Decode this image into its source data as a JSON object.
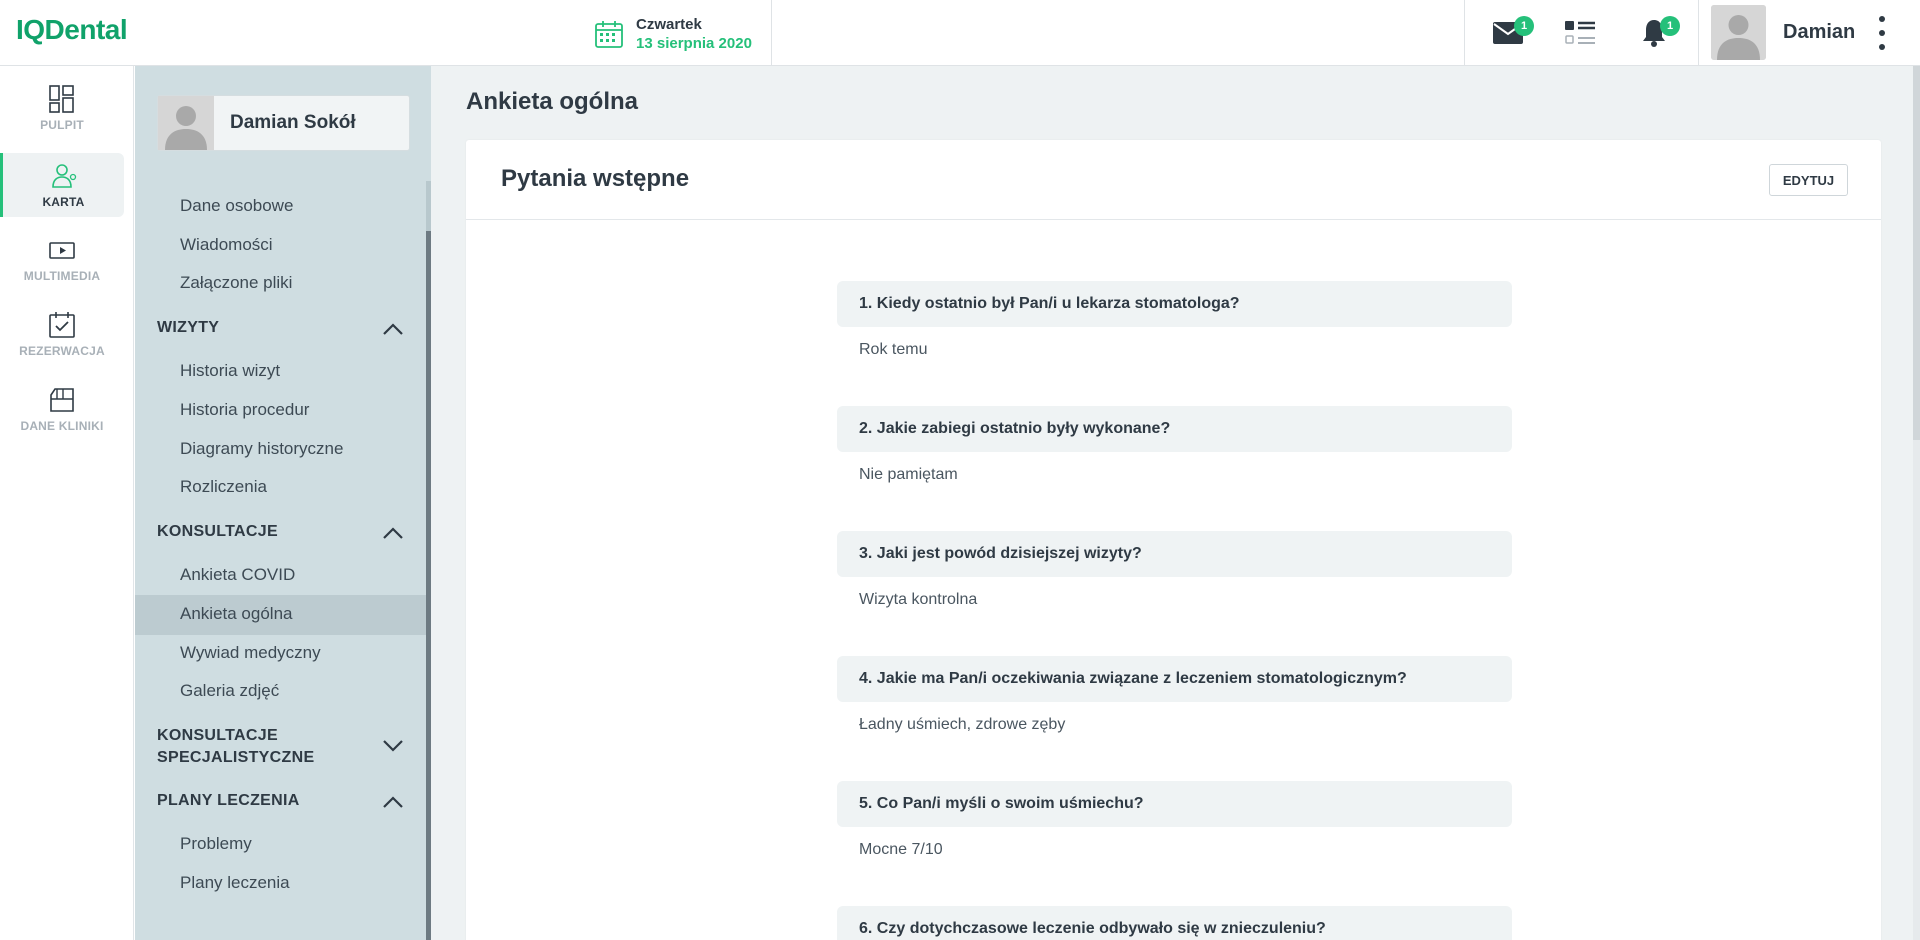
{
  "app": {
    "logo": "IQDental"
  },
  "header": {
    "day": "Czwartek",
    "date": "13 sierpnia 2020",
    "mail_badge": "1",
    "notif_badge": "1",
    "user_name": "Damian"
  },
  "rail": {
    "items": [
      {
        "label": "PULPIT",
        "icon": "dashboard-icon"
      },
      {
        "label": "KARTA",
        "icon": "patient-card-icon"
      },
      {
        "label": "MULTIMEDIA",
        "icon": "multimedia-icon"
      },
      {
        "label": "REZERWACJA",
        "icon": "calendar-check-icon"
      },
      {
        "label": "DANE KLINIKI",
        "icon": "clinic-data-icon"
      }
    ],
    "active": "KARTA"
  },
  "sidebar": {
    "patient_name": "Damian Sokół",
    "top_links": [
      "Dane osobowe",
      "Wiadomości",
      "Załączone pliki"
    ],
    "sections": [
      {
        "title": "WIZYTY",
        "expanded": true,
        "links": [
          "Historia wizyt",
          "Historia procedur",
          "Diagramy historyczne",
          "Rozliczenia"
        ]
      },
      {
        "title": "KONSULTACJE",
        "expanded": true,
        "links": [
          "Ankieta COVID",
          "Ankieta ogólna",
          "Wywiad medyczny",
          "Galeria zdjęć"
        ]
      },
      {
        "title_line1": "KONSULTACJE",
        "title_line2": "SPECJALISTYCZNE",
        "expanded": false,
        "links": []
      },
      {
        "title": "PLANY LECZENIA",
        "expanded": true,
        "links": [
          "Problemy",
          "Plany leczenia"
        ]
      }
    ],
    "active_link": "Ankieta ogólna"
  },
  "main": {
    "page_title": "Ankieta ogólna",
    "card_title": "Pytania wstępne",
    "edit_label": "EDYTUJ",
    "questions": [
      {
        "q": "1. Kiedy ostatnio był Pan/i u lekarza stomatologa?",
        "a": "Rok temu"
      },
      {
        "q": "2. Jakie zabiegi ostatnio były wykonane?",
        "a": "Nie pamiętam"
      },
      {
        "q": "3. Jaki jest powód dzisiejszej wizyty?",
        "a": "Wizyta kontrolna"
      },
      {
        "q": "4. Jakie ma Pan/i oczekiwania związane z leczeniem stomatologicznym?",
        "a": "Ładny uśmiech, zdrowe zęby"
      },
      {
        "q": "5. Co Pan/i myśli o swoim uśmiechu?",
        "a": "Mocne 7/10"
      },
      {
        "q": "6. Czy dotychczasowe leczenie odbywało się w znieczuleniu?",
        "a": ""
      }
    ]
  },
  "colors": {
    "accent": "#25c07a",
    "logo": "#10a26a",
    "sidebar_bg": "#cfdde1",
    "main_bg": "#eef2f3"
  }
}
